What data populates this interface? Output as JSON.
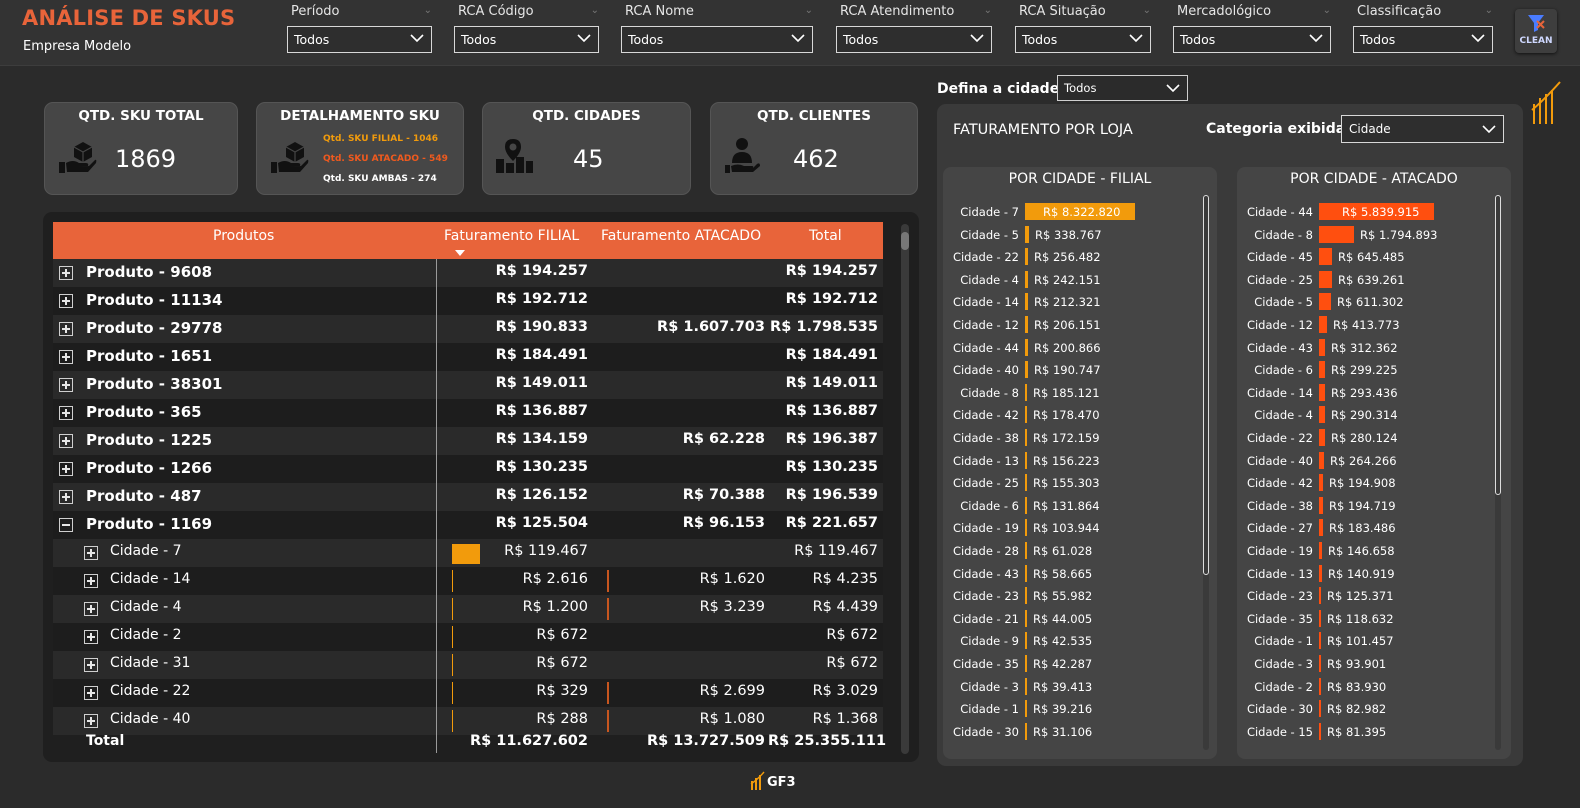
{
  "app": {
    "title": "ANÁLISE DE SKUS",
    "subtitle": "Empresa Modelo"
  },
  "filters": [
    {
      "label": "Período",
      "value": "Todos"
    },
    {
      "label": "RCA Código",
      "value": "Todos"
    },
    {
      "label": "RCA Nome",
      "value": "Todos"
    },
    {
      "label": "RCA Atendimento",
      "value": "Todos"
    },
    {
      "label": "RCA Situação",
      "value": "Todos"
    },
    {
      "label": "Mercadológico",
      "value": "Todos"
    },
    {
      "label": "Classificação",
      "value": "Todos"
    }
  ],
  "clean_button": {
    "label": "CLEAN"
  },
  "kpis": {
    "sku_total": {
      "title": "QTD. SKU TOTAL",
      "value": "1869"
    },
    "detalhamento": {
      "title": "DETALHAMENTO SKU",
      "lines": [
        {
          "text": "Qtd. SKU FILIAL - 1046",
          "color": "#f29b0c"
        },
        {
          "text": "Qtd. SKU ATACADO - 549",
          "color": "#f05a1e"
        },
        {
          "text": "Qtd. SKU AMBAS - 274",
          "color": "#ffffff"
        }
      ]
    },
    "cidades": {
      "title": "QTD. CIDADES",
      "value": "45"
    },
    "clientes": {
      "title": "QTD. CLIENTES",
      "value": "462"
    }
  },
  "table": {
    "headers": {
      "produtos": "Produtos",
      "filial": "Faturamento FILIAL",
      "atacado": "Faturamento ATACADO",
      "total": "Total"
    },
    "rows": [
      {
        "label": "Produto - 9608",
        "level": 0,
        "expanded": false,
        "filial": "R$ 194.257",
        "atacado": "",
        "total": "R$ 194.257"
      },
      {
        "label": "Produto - 11134",
        "level": 0,
        "expanded": false,
        "filial": "R$ 192.712",
        "atacado": "",
        "total": "R$ 192.712"
      },
      {
        "label": "Produto - 29778",
        "level": 0,
        "expanded": false,
        "filial": "R$ 190.833",
        "atacado": "R$ 1.607.703",
        "total": "R$ 1.798.535"
      },
      {
        "label": "Produto - 1651",
        "level": 0,
        "expanded": false,
        "filial": "R$ 184.491",
        "atacado": "",
        "total": "R$ 184.491"
      },
      {
        "label": "Produto - 38301",
        "level": 0,
        "expanded": false,
        "filial": "R$ 149.011",
        "atacado": "",
        "total": "R$ 149.011"
      },
      {
        "label": "Produto - 365",
        "level": 0,
        "expanded": false,
        "filial": "R$ 136.887",
        "atacado": "",
        "total": "R$ 136.887"
      },
      {
        "label": "Produto - 1225",
        "level": 0,
        "expanded": false,
        "filial": "R$ 134.159",
        "atacado": "R$ 62.228",
        "total": "R$ 196.387"
      },
      {
        "label": "Produto - 1266",
        "level": 0,
        "expanded": false,
        "filial": "R$ 130.235",
        "atacado": "",
        "total": "R$ 130.235"
      },
      {
        "label": "Produto - 487",
        "level": 0,
        "expanded": false,
        "filial": "R$ 126.152",
        "atacado": "R$ 70.388",
        "total": "R$ 196.539"
      },
      {
        "label": "Produto - 1169",
        "level": 0,
        "expanded": true,
        "filial": "R$ 125.504",
        "atacado": "R$ 96.153",
        "total": "R$ 221.657"
      },
      {
        "label": "Cidade - 7",
        "level": 1,
        "expanded": false,
        "filial": "R$ 119.467",
        "atacado": "",
        "total": "R$ 119.467",
        "filial_share": 1.0,
        "atacado_share": 0
      },
      {
        "label": "Cidade - 14",
        "level": 1,
        "expanded": false,
        "filial": "R$ 2.616",
        "atacado": "R$ 1.620",
        "total": "R$ 4.235",
        "filial_share": 0.02,
        "atacado_share": 0.02
      },
      {
        "label": "Cidade - 4",
        "level": 1,
        "expanded": false,
        "filial": "R$ 1.200",
        "atacado": "R$ 3.239",
        "total": "R$ 4.439",
        "filial_share": 0.01,
        "atacado_share": 0.03
      },
      {
        "label": "Cidade - 2",
        "level": 1,
        "expanded": false,
        "filial": "R$ 672",
        "atacado": "",
        "total": "R$ 672",
        "filial_share": 0.005,
        "atacado_share": 0
      },
      {
        "label": "Cidade - 31",
        "level": 1,
        "expanded": false,
        "filial": "R$ 672",
        "atacado": "",
        "total": "R$ 672",
        "filial_share": 0.005,
        "atacado_share": 0
      },
      {
        "label": "Cidade - 22",
        "level": 1,
        "expanded": false,
        "filial": "R$ 329",
        "atacado": "R$ 2.699",
        "total": "R$ 3.029",
        "filial_share": 0.003,
        "atacado_share": 0.02
      },
      {
        "label": "Cidade - 40",
        "level": 1,
        "expanded": false,
        "filial": "R$ 288",
        "atacado": "R$ 1.080",
        "total": "R$ 1.368",
        "filial_share": 0.002,
        "atacado_share": 0.01
      }
    ],
    "total": {
      "label": "Total",
      "filial": "R$ 11.627.602",
      "atacado": "R$ 13.727.509",
      "total": "R$ 25.355.111"
    }
  },
  "city_filter": {
    "label": "Defina a cidade:",
    "value": "Todos"
  },
  "store_panel": {
    "title": "FATURAMENTO POR LOJA",
    "category_label": "Categoria exibida:",
    "category_value": "Cidade",
    "filial": {
      "title": "POR CIDADE - FILIAL",
      "color": "#f29b0c",
      "rows": [
        {
          "cat": "Cidade - 7",
          "label": "R$ 8.322.820",
          "value": 8322820
        },
        {
          "cat": "Cidade - 5",
          "label": "R$ 338.767",
          "value": 338767
        },
        {
          "cat": "Cidade - 22",
          "label": "R$ 256.482",
          "value": 256482
        },
        {
          "cat": "Cidade - 4",
          "label": "R$ 242.151",
          "value": 242151
        },
        {
          "cat": "Cidade - 14",
          "label": "R$ 212.321",
          "value": 212321
        },
        {
          "cat": "Cidade - 12",
          "label": "R$ 206.151",
          "value": 206151
        },
        {
          "cat": "Cidade - 44",
          "label": "R$ 200.866",
          "value": 200866
        },
        {
          "cat": "Cidade - 40",
          "label": "R$ 190.747",
          "value": 190747
        },
        {
          "cat": "Cidade - 8",
          "label": "R$ 185.121",
          "value": 185121
        },
        {
          "cat": "Cidade - 42",
          "label": "R$ 178.470",
          "value": 178470
        },
        {
          "cat": "Cidade - 38",
          "label": "R$ 172.159",
          "value": 172159
        },
        {
          "cat": "Cidade - 13",
          "label": "R$ 156.223",
          "value": 156223
        },
        {
          "cat": "Cidade - 25",
          "label": "R$ 155.303",
          "value": 155303
        },
        {
          "cat": "Cidade - 6",
          "label": "R$ 131.864",
          "value": 131864
        },
        {
          "cat": "Cidade - 19",
          "label": "R$ 103.944",
          "value": 103944
        },
        {
          "cat": "Cidade - 28",
          "label": "R$ 61.028",
          "value": 61028
        },
        {
          "cat": "Cidade - 43",
          "label": "R$ 58.665",
          "value": 58665
        },
        {
          "cat": "Cidade - 23",
          "label": "R$ 55.982",
          "value": 55982
        },
        {
          "cat": "Cidade - 21",
          "label": "R$ 44.005",
          "value": 44005
        },
        {
          "cat": "Cidade - 9",
          "label": "R$ 42.535",
          "value": 42535
        },
        {
          "cat": "Cidade - 35",
          "label": "R$ 42.287",
          "value": 42287
        },
        {
          "cat": "Cidade - 3",
          "label": "R$ 39.413",
          "value": 39413
        },
        {
          "cat": "Cidade - 1",
          "label": "R$ 39.216",
          "value": 39216
        },
        {
          "cat": "Cidade - 30",
          "label": "R$ 31.106",
          "value": 31106
        }
      ]
    },
    "atacado": {
      "title": "POR CIDADE - ATACADO",
      "color": "#ff4f0f",
      "rows": [
        {
          "cat": "Cidade - 44",
          "label": "R$ 5.839.915",
          "value": 5839915
        },
        {
          "cat": "Cidade - 8",
          "label": "R$ 1.794.893",
          "value": 1794893
        },
        {
          "cat": "Cidade - 45",
          "label": "R$ 645.485",
          "value": 645485
        },
        {
          "cat": "Cidade - 25",
          "label": "R$ 639.261",
          "value": 639261
        },
        {
          "cat": "Cidade - 5",
          "label": "R$ 611.302",
          "value": 611302
        },
        {
          "cat": "Cidade - 12",
          "label": "R$ 413.773",
          "value": 413773
        },
        {
          "cat": "Cidade - 43",
          "label": "R$ 312.362",
          "value": 312362
        },
        {
          "cat": "Cidade - 6",
          "label": "R$ 299.225",
          "value": 299225
        },
        {
          "cat": "Cidade - 14",
          "label": "R$ 293.436",
          "value": 293436
        },
        {
          "cat": "Cidade - 4",
          "label": "R$ 290.314",
          "value": 290314
        },
        {
          "cat": "Cidade - 22",
          "label": "R$ 280.124",
          "value": 280124
        },
        {
          "cat": "Cidade - 40",
          "label": "R$ 264.266",
          "value": 264266
        },
        {
          "cat": "Cidade - 42",
          "label": "R$ 194.908",
          "value": 194908
        },
        {
          "cat": "Cidade - 38",
          "label": "R$ 194.719",
          "value": 194719
        },
        {
          "cat": "Cidade - 27",
          "label": "R$ 183.486",
          "value": 183486
        },
        {
          "cat": "Cidade - 19",
          "label": "R$ 146.658",
          "value": 146658
        },
        {
          "cat": "Cidade - 13",
          "label": "R$ 140.919",
          "value": 140919
        },
        {
          "cat": "Cidade - 23",
          "label": "R$ 125.371",
          "value": 125371
        },
        {
          "cat": "Cidade - 35",
          "label": "R$ 118.632",
          "value": 118632
        },
        {
          "cat": "Cidade - 1",
          "label": "R$ 101.457",
          "value": 101457
        },
        {
          "cat": "Cidade - 3",
          "label": "R$ 93.901",
          "value": 93901
        },
        {
          "cat": "Cidade - 2",
          "label": "R$ 83.930",
          "value": 83930
        },
        {
          "cat": "Cidade - 30",
          "label": "R$ 82.982",
          "value": 82982
        },
        {
          "cat": "Cidade - 15",
          "label": "R$ 81.395",
          "value": 81395
        }
      ]
    }
  },
  "brand": {
    "logo_text": "GF3"
  }
}
